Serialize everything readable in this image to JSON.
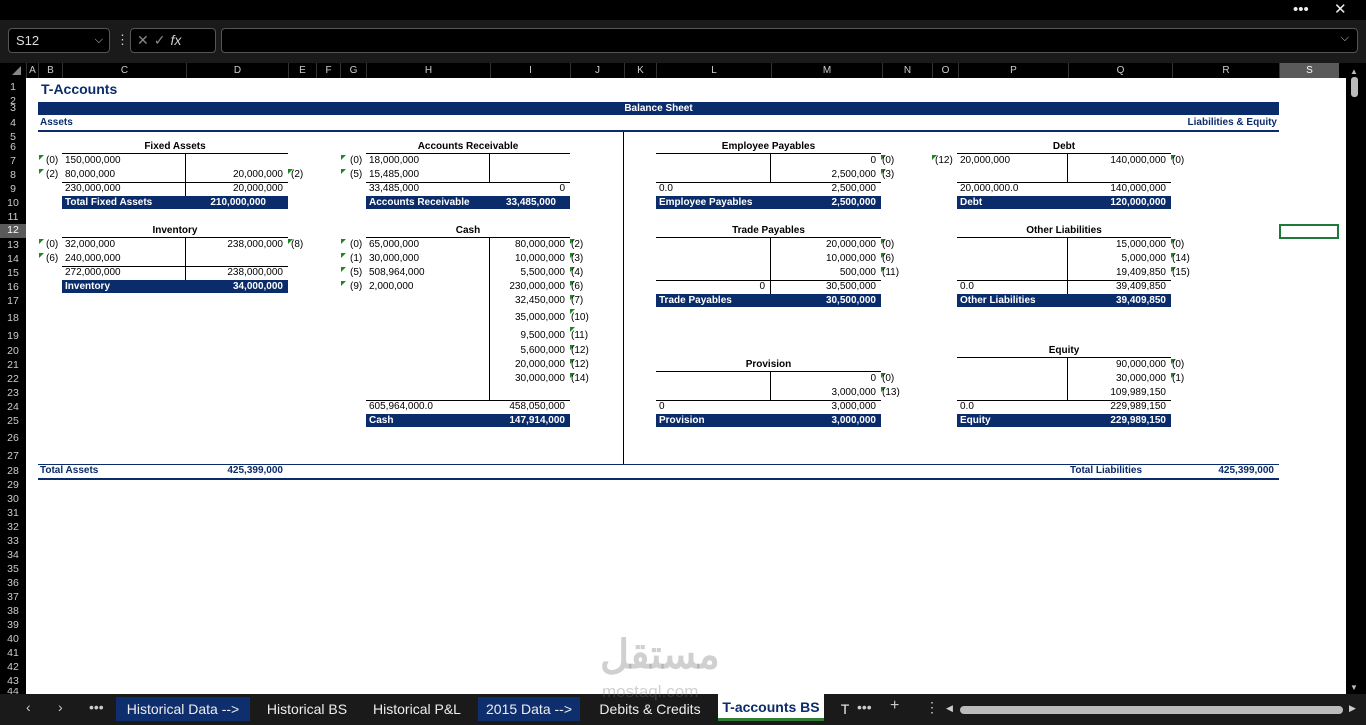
{
  "namebox": {
    "value": "S12"
  },
  "columns": [
    "A",
    "B",
    "C",
    "D",
    "E",
    "F",
    "G",
    "H",
    "I",
    "J",
    "K",
    "L",
    "M",
    "N",
    "O",
    "P",
    "Q",
    "R",
    "S"
  ],
  "rows": [
    "1",
    "2",
    "3",
    "4",
    "5",
    "6",
    "7",
    "8",
    "9",
    "10",
    "11",
    "12",
    "13",
    "14",
    "15",
    "16",
    "17",
    "18",
    "19",
    "20",
    "21",
    "22",
    "23",
    "24",
    "25",
    "26",
    "27",
    "28",
    "29",
    "30",
    "31",
    "32",
    "33",
    "34",
    "35",
    "36",
    "37",
    "38",
    "39",
    "40",
    "41",
    "42",
    "43",
    "44"
  ],
  "sheet": {
    "title": "T-Accounts",
    "banner": "Balance Sheet",
    "assets": "Assets",
    "liab_equity": "Liabilities & Equity",
    "total_assets_label": "Total Assets",
    "total_assets_value": "425,399,000",
    "total_liab_label": "Total Liabilities",
    "total_liab_value": "425,399,000"
  },
  "accounts": {
    "fixed": {
      "title": "Fixed Assets",
      "l1": "(0)",
      "v1": "150,000,000",
      "l2": "(2)",
      "v2": "80,000,000",
      "c1": "20,000,000",
      "cr1": "(2)",
      "sl": "230,000,000",
      "sr": "20,000,000",
      "bl": "Total Fixed Assets",
      "bv": "210,000,000"
    },
    "ar": {
      "title": "Accounts Receivable",
      "l1": "(0)",
      "v1": "18,000,000",
      "l2": "(5)",
      "v2": "15,485,000",
      "sl": "33,485,000",
      "sr": "0",
      "bl": "Accounts Receivable",
      "bv": "33,485,000"
    },
    "inv": {
      "title": "Inventory",
      "l1": "(0)",
      "v1": "32,000,000",
      "l2": "(6)",
      "v2": "240,000,000",
      "c1": "238,000,000",
      "cr1": "(8)",
      "sl": "272,000,000",
      "sr": "238,000,000",
      "bl": "Inventory",
      "bv": "34,000,000"
    },
    "cash": {
      "title": "Cash",
      "dl": [
        "(0)",
        "(1)",
        "(5)",
        "(9)"
      ],
      "dv": [
        "65,000,000",
        "30,000,000",
        "508,964,000",
        "2,000,000"
      ],
      "cv": [
        "80,000,000",
        "10,000,000",
        "5,500,000",
        "230,000,000",
        "32,450,000",
        "35,000,000",
        "9,500,000",
        "5,600,000",
        "20,000,000",
        "30,000,000"
      ],
      "cl": [
        "(2)",
        "(3)",
        "(4)",
        "(6)",
        "(7)",
        "(10)",
        "(11)",
        "(12)",
        "(12)",
        "(14)"
      ],
      "sl": "605,964,000.0",
      "sr": "458,050,000",
      "bl": "Cash",
      "bv": "147,914,000"
    },
    "emp": {
      "title": "Employee Payables",
      "c1": "0",
      "cr1": "(0)",
      "c2": "2,500,000",
      "cr2": "(3)",
      "sl": "0.0",
      "sr": "2,500,000",
      "bl": "Employee Payables",
      "bv": "2,500,000"
    },
    "debt": {
      "title": "Debt",
      "l1": "(12)",
      "v1": "20,000,000",
      "c1": "140,000,000",
      "cr1": "(0)",
      "sl": "20,000,000.0",
      "sr": "140,000,000",
      "bl": "Debt",
      "bv": "120,000,000"
    },
    "trade": {
      "title": "Trade Payables",
      "c1": "20,000,000",
      "cr1": "(0)",
      "c2": "10,000,000",
      "cr2": "(6)",
      "c3": "500,000",
      "cr3": "(11)",
      "sl": "0",
      "sr": "30,500,000",
      "bl": "Trade Payables",
      "bv": "30,500,000"
    },
    "other": {
      "title": "Other Liabilities",
      "c1": "15,000,000",
      "cr1": "(0)",
      "c2": "5,000,000",
      "cr2": "(14)",
      "c3": "19,409,850",
      "cr3": "(15)",
      "sl": "0.0",
      "sr": "39,409,850",
      "bl": "Other Liabilities",
      "bv": "39,409,850"
    },
    "prov": {
      "title": "Provision",
      "c1": "0",
      "cr1": "(0)",
      "c2": "3,000,000",
      "cr2": "(13)",
      "sl": "0",
      "sr": "3,000,000",
      "bl": "Provision",
      "bv": "3,000,000"
    },
    "equity": {
      "title": "Equity",
      "c1": "90,000,000",
      "cr1": "(0)",
      "c2": "30,000,000",
      "cr2": "(1)",
      "c3": "109,989,150",
      "sl": "0.0",
      "sr": "229,989,150",
      "bl": "Equity",
      "bv": "229,989,150"
    }
  },
  "tabs": {
    "historical_data": "Historical Data -->",
    "historical_bs": "Historical BS",
    "historical_pl": "Historical P&L",
    "data_2015": "2015 Data -->",
    "debits_credits": "Debits & Credits",
    "t_accounts_bs": "T-accounts BS",
    "t_more": "T"
  },
  "watermark": {
    "arabic": "مستقل",
    "latin": "mostaql.com"
  }
}
